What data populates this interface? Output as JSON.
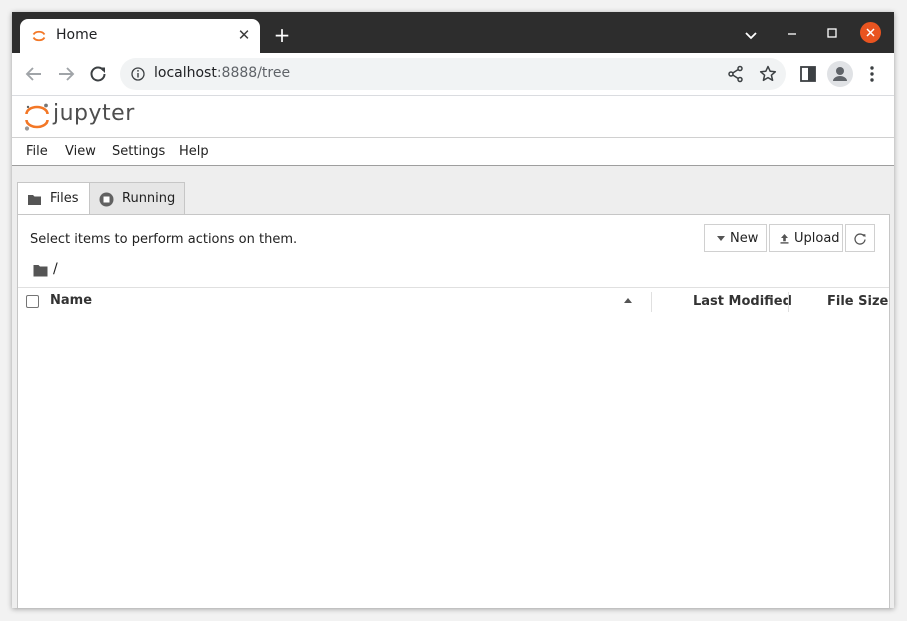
{
  "browser": {
    "tab_title": "Home",
    "tab_close": "✕",
    "new_tab": "+",
    "url_host": "localhost",
    "url_path": ":8888/tree"
  },
  "jupyter": {
    "brand": "jupyter",
    "menu": [
      "File",
      "View",
      "Settings",
      "Help"
    ],
    "tabs": [
      {
        "label": "Files",
        "active": true
      },
      {
        "label": "Running",
        "active": false
      }
    ],
    "instructions": "Select items to perform actions on them.",
    "buttons": {
      "new": "New",
      "upload": "Upload"
    },
    "breadcrumb": "/",
    "columns": {
      "name": "Name",
      "modified": "Last Modified",
      "size": "File Size"
    },
    "sort": {
      "column": "Name",
      "direction": "ascending"
    },
    "files": []
  },
  "colors": {
    "titlebar": "#2d2d2d",
    "close_button": "#e95420",
    "jupyter_orange": "#f37726",
    "omnibox": "#f1f3f4"
  }
}
